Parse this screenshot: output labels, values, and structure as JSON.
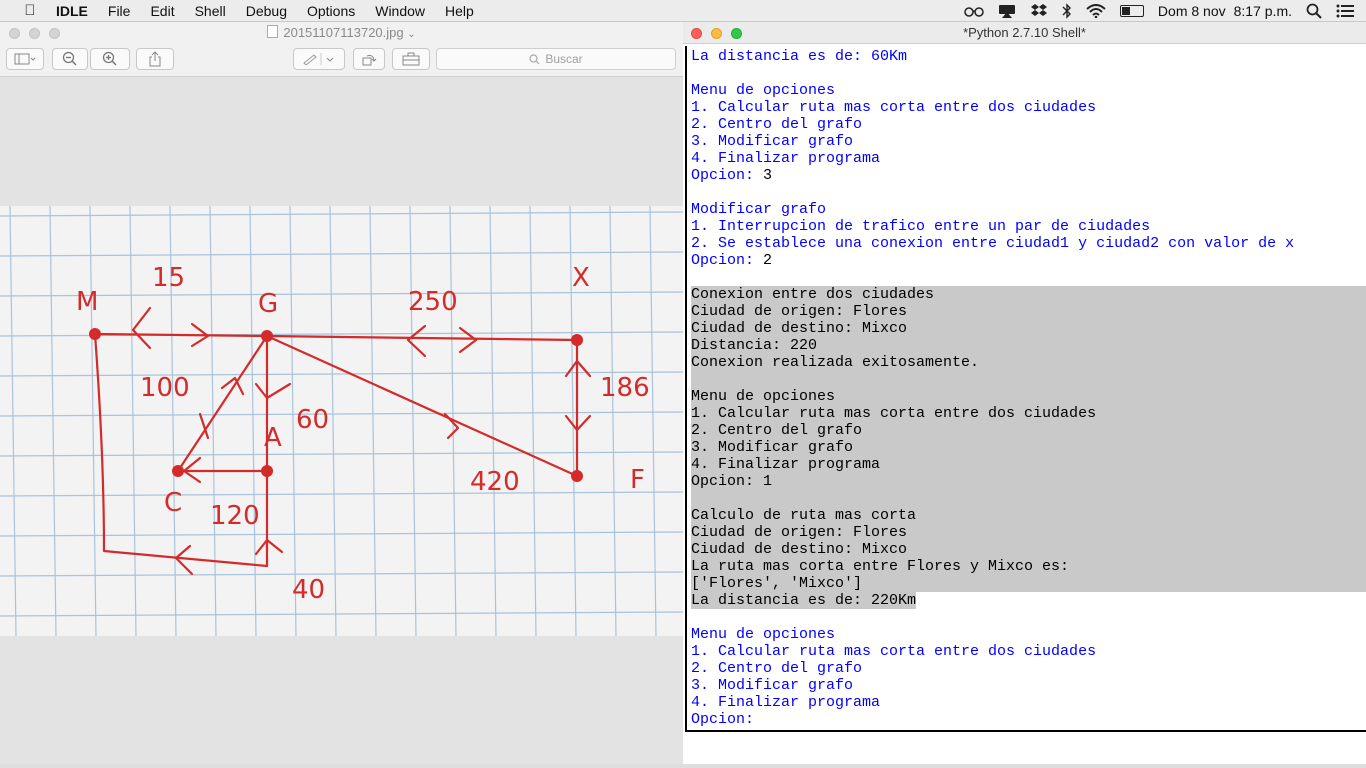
{
  "menubar": {
    "app_name": "IDLE",
    "menus": [
      "File",
      "Edit",
      "Shell",
      "Debug",
      "Options",
      "Window",
      "Help"
    ],
    "date": "Dom 8 nov",
    "time": "8:17 p.m.",
    "status_icons": [
      "glasses-icon",
      "airplay-icon",
      "dropbox-icon",
      "bluetooth-icon",
      "wifi-icon",
      "battery-icon",
      "spotlight-icon",
      "notification-list-icon"
    ]
  },
  "preview": {
    "filename": "20151107113720.jpg",
    "search_placeholder": "Buscar",
    "sketch": {
      "nodes": [
        "M",
        "G",
        "X",
        "A",
        "C",
        "F"
      ],
      "edge_labels": [
        "15",
        "250",
        "100",
        "60",
        "186",
        "120",
        "420",
        "40"
      ],
      "ink_color": "#d42a2a"
    }
  },
  "shell": {
    "title": "*Python 2.7.10 Shell*",
    "colors": {
      "output": "#0000ff",
      "input": "#000000",
      "selection": "#c9c9c9"
    },
    "lines": [
      {
        "text": "La distancia es de: 60Km",
        "style": "out"
      },
      {
        "text": "",
        "style": "out"
      },
      {
        "text": "Menu de opciones",
        "style": "out"
      },
      {
        "text": "1. Calcular ruta mas corta entre dos ciudades",
        "style": "out"
      },
      {
        "text": "2. Centro del grafo",
        "style": "out"
      },
      {
        "text": "3. Modificar grafo",
        "style": "out"
      },
      {
        "text": "4. Finalizar programa",
        "style": "out"
      },
      {
        "text": "Opcion: ",
        "style": "out",
        "input": "3"
      },
      {
        "text": "",
        "style": "out"
      },
      {
        "text": "Modificar grafo",
        "style": "out"
      },
      {
        "text": "1. Interrupcion de trafico entre un par de ciudades",
        "style": "out"
      },
      {
        "text": "2. Se establece una conexion entre ciudad1 y ciudad2 con valor de x",
        "style": "out"
      },
      {
        "text": "Opcion: ",
        "style": "out",
        "input": "2"
      },
      {
        "text": "",
        "style": "out"
      },
      {
        "text": "Conexion entre dos ciudades",
        "style": "sel"
      },
      {
        "text": "Ciudad de origen: Flores",
        "style": "sel"
      },
      {
        "text": "Ciudad de destino: Mixco",
        "style": "sel"
      },
      {
        "text": "Distancia: 220",
        "style": "sel"
      },
      {
        "text": "Conexion realizada exitosamente.",
        "style": "sel"
      },
      {
        "text": "",
        "style": "sel"
      },
      {
        "text": "Menu de opciones",
        "style": "sel"
      },
      {
        "text": "1. Calcular ruta mas corta entre dos ciudades",
        "style": "sel"
      },
      {
        "text": "2. Centro del grafo",
        "style": "sel"
      },
      {
        "text": "3. Modificar grafo",
        "style": "sel"
      },
      {
        "text": "4. Finalizar programa",
        "style": "sel"
      },
      {
        "text": "Opcion: 1",
        "style": "sel"
      },
      {
        "text": "",
        "style": "sel"
      },
      {
        "text": "Calculo de ruta mas corta",
        "style": "sel"
      },
      {
        "text": "Ciudad de origen: Flores",
        "style": "sel"
      },
      {
        "text": "Ciudad de destino: Mixco",
        "style": "sel"
      },
      {
        "text": "La ruta mas corta entre Flores y Mixco es:",
        "style": "sel"
      },
      {
        "text": "['Flores', 'Mixco']",
        "style": "sel"
      },
      {
        "text": "La distancia es de: 220Km",
        "style": "sel-partial"
      },
      {
        "text": "",
        "style": "out"
      },
      {
        "text": "Menu de opciones",
        "style": "out"
      },
      {
        "text": "1. Calcular ruta mas corta entre dos ciudades",
        "style": "out"
      },
      {
        "text": "2. Centro del grafo",
        "style": "out"
      },
      {
        "text": "3. Modificar grafo",
        "style": "out"
      },
      {
        "text": "4. Finalizar programa",
        "style": "out"
      },
      {
        "text": "Opcion: ",
        "style": "out"
      }
    ]
  }
}
